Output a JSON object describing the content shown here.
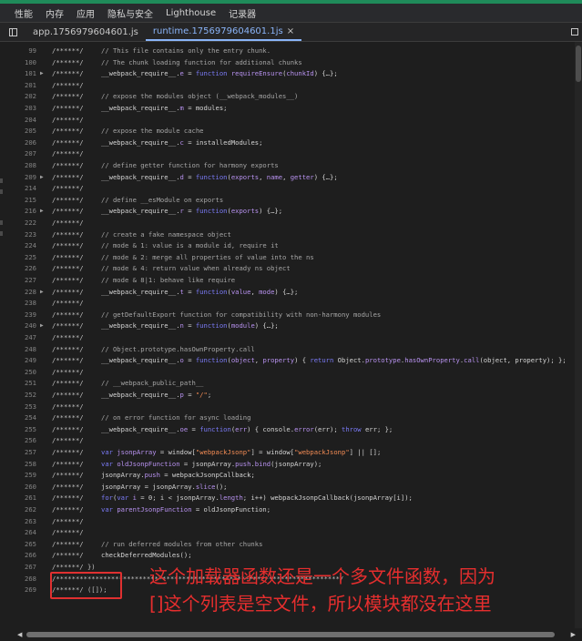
{
  "panel_tabs": [
    "性能",
    "内存",
    "应用",
    "隐私与安全",
    "Lighthouse",
    "记录器"
  ],
  "file_tabs": {
    "app": "app.1756979604601.js",
    "runtime": "runtime.1756979604601.1js",
    "close_glyph": "×"
  },
  "code_lines": [
    {
      "n": "99",
      "f": "",
      "wp": "/******/",
      "t": [
        [
          "// This file contains only the entry chunk.",
          "c"
        ]
      ]
    },
    {
      "n": "100",
      "f": "",
      "wp": "/******/",
      "t": [
        [
          "// The chunk loading function for additional chunks",
          "c"
        ]
      ]
    },
    {
      "n": "101",
      "f": "▶",
      "wp": "/******/",
      "t": [
        [
          "__webpack_require__.",
          ""
        ],
        [
          "e",
          "p"
        ],
        [
          " = ",
          ""
        ],
        [
          "function",
          "k"
        ],
        [
          " ",
          ""
        ],
        [
          "requireEnsure",
          "p"
        ],
        [
          "(",
          ""
        ],
        [
          "chunkId",
          "p"
        ],
        [
          ") {…};",
          ""
        ]
      ]
    },
    {
      "n": "201",
      "f": "",
      "wp": "/******/",
      "t": []
    },
    {
      "n": "202",
      "f": "",
      "wp": "/******/",
      "t": [
        [
          "// expose the modules object (__webpack_modules__)",
          "c"
        ]
      ]
    },
    {
      "n": "203",
      "f": "",
      "wp": "/******/",
      "t": [
        [
          "__webpack_require__.",
          ""
        ],
        [
          "m",
          "p"
        ],
        [
          " = modules;",
          ""
        ]
      ]
    },
    {
      "n": "204",
      "f": "",
      "wp": "/******/",
      "t": []
    },
    {
      "n": "205",
      "f": "",
      "wp": "/******/",
      "t": [
        [
          "// expose the module cache",
          "c"
        ]
      ]
    },
    {
      "n": "206",
      "f": "",
      "wp": "/******/",
      "t": [
        [
          "__webpack_require__.",
          ""
        ],
        [
          "c",
          "p"
        ],
        [
          " = installedModules;",
          ""
        ]
      ]
    },
    {
      "n": "207",
      "f": "",
      "wp": "/******/",
      "t": []
    },
    {
      "n": "208",
      "f": "",
      "wp": "/******/",
      "t": [
        [
          "// define getter function for harmony exports",
          "c"
        ]
      ]
    },
    {
      "n": "209",
      "f": "▶",
      "wp": "/******/",
      "t": [
        [
          "__webpack_require__.",
          ""
        ],
        [
          "d",
          "p"
        ],
        [
          " = ",
          ""
        ],
        [
          "function",
          "k"
        ],
        [
          "(",
          ""
        ],
        [
          "exports",
          "p"
        ],
        [
          ", ",
          ""
        ],
        [
          "name",
          "p"
        ],
        [
          ", ",
          ""
        ],
        [
          "getter",
          "p"
        ],
        [
          ") {…};",
          ""
        ]
      ]
    },
    {
      "n": "214",
      "f": "",
      "wp": "/******/",
      "t": []
    },
    {
      "n": "215",
      "f": "",
      "wp": "/******/",
      "t": [
        [
          "// define __esModule on exports",
          "c"
        ]
      ]
    },
    {
      "n": "216",
      "f": "▶",
      "wp": "/******/",
      "t": [
        [
          "__webpack_require__.",
          ""
        ],
        [
          "r",
          "p"
        ],
        [
          " = ",
          ""
        ],
        [
          "function",
          "k"
        ],
        [
          "(",
          ""
        ],
        [
          "exports",
          "p"
        ],
        [
          ") {…};",
          ""
        ]
      ]
    },
    {
      "n": "222",
      "f": "",
      "wp": "/******/",
      "t": []
    },
    {
      "n": "223",
      "f": "",
      "wp": "/******/",
      "t": [
        [
          "// create a fake namespace object",
          "c"
        ]
      ]
    },
    {
      "n": "224",
      "f": "",
      "wp": "/******/",
      "t": [
        [
          "// mode & 1: value is a module id, require it",
          "c"
        ]
      ]
    },
    {
      "n": "225",
      "f": "",
      "wp": "/******/",
      "t": [
        [
          "// mode & 2: merge all properties of value into the ns",
          "c"
        ]
      ]
    },
    {
      "n": "226",
      "f": "",
      "wp": "/******/",
      "t": [
        [
          "// mode & 4: return value when already ns object",
          "c"
        ]
      ]
    },
    {
      "n": "227",
      "f": "",
      "wp": "/******/",
      "t": [
        [
          "// mode & 8|1: behave like require",
          "c"
        ]
      ]
    },
    {
      "n": "228",
      "f": "▶",
      "wp": "/******/",
      "t": [
        [
          "__webpack_require__.",
          ""
        ],
        [
          "t",
          "p"
        ],
        [
          " = ",
          ""
        ],
        [
          "function",
          "k"
        ],
        [
          "(",
          ""
        ],
        [
          "value",
          "p"
        ],
        [
          ", ",
          ""
        ],
        [
          "mode",
          "p"
        ],
        [
          ") {…};",
          ""
        ]
      ]
    },
    {
      "n": "238",
      "f": "",
      "wp": "/******/",
      "t": []
    },
    {
      "n": "239",
      "f": "",
      "wp": "/******/",
      "t": [
        [
          "// getDefaultExport function for compatibility with non-harmony modules",
          "c"
        ]
      ]
    },
    {
      "n": "240",
      "f": "▶",
      "wp": "/******/",
      "t": [
        [
          "__webpack_require__.",
          ""
        ],
        [
          "n",
          "p"
        ],
        [
          " = ",
          ""
        ],
        [
          "function",
          "k"
        ],
        [
          "(",
          ""
        ],
        [
          "module",
          "p"
        ],
        [
          ") {…};",
          ""
        ]
      ]
    },
    {
      "n": "247",
      "f": "",
      "wp": "/******/",
      "t": []
    },
    {
      "n": "248",
      "f": "",
      "wp": "/******/",
      "t": [
        [
          "// Object.prototype.hasOwnProperty.call",
          "c"
        ]
      ]
    },
    {
      "n": "249",
      "f": "",
      "wp": "/******/",
      "t": [
        [
          "__webpack_require__.",
          ""
        ],
        [
          "o",
          "p"
        ],
        [
          " = ",
          ""
        ],
        [
          "function",
          "k"
        ],
        [
          "(",
          ""
        ],
        [
          "object",
          "p"
        ],
        [
          ", ",
          ""
        ],
        [
          "property",
          "p"
        ],
        [
          ") { ",
          ""
        ],
        [
          "return",
          "k"
        ],
        [
          " Object.",
          ""
        ],
        [
          "prototype",
          "p"
        ],
        [
          ".",
          ""
        ],
        [
          "hasOwnProperty",
          "p"
        ],
        [
          ".",
          ""
        ],
        [
          "call",
          "p"
        ],
        [
          "(object, property); };",
          ""
        ]
      ]
    },
    {
      "n": "250",
      "f": "",
      "wp": "/******/",
      "t": []
    },
    {
      "n": "251",
      "f": "",
      "wp": "/******/",
      "t": [
        [
          "// __webpack_public_path__",
          "c"
        ]
      ]
    },
    {
      "n": "252",
      "f": "",
      "wp": "/******/",
      "t": [
        [
          "__webpack_require__.",
          ""
        ],
        [
          "p",
          "p"
        ],
        [
          " = ",
          ""
        ],
        [
          "\"/\"",
          "s"
        ],
        [
          ";",
          ""
        ]
      ]
    },
    {
      "n": "253",
      "f": "",
      "wp": "/******/",
      "t": []
    },
    {
      "n": "254",
      "f": "",
      "wp": "/******/",
      "t": [
        [
          "// on error function for async loading",
          "c"
        ]
      ]
    },
    {
      "n": "255",
      "f": "",
      "wp": "/******/",
      "t": [
        [
          "__webpack_require__.",
          ""
        ],
        [
          "oe",
          "p"
        ],
        [
          " = ",
          ""
        ],
        [
          "function",
          "k"
        ],
        [
          "(",
          ""
        ],
        [
          "err",
          "p"
        ],
        [
          ") { console.",
          ""
        ],
        [
          "error",
          "p"
        ],
        [
          "(err); ",
          ""
        ],
        [
          "throw",
          "k"
        ],
        [
          " err; };",
          ""
        ]
      ]
    },
    {
      "n": "256",
      "f": "",
      "wp": "/******/",
      "t": []
    },
    {
      "n": "257",
      "f": "",
      "wp": "/******/",
      "t": [
        [
          "var",
          "k"
        ],
        [
          " ",
          ""
        ],
        [
          "jsonpArray",
          "p"
        ],
        [
          " = window[",
          ""
        ],
        [
          "\"webpackJsonp\"",
          "s"
        ],
        [
          "] = window[",
          ""
        ],
        [
          "\"webpackJsonp\"",
          "s"
        ],
        [
          "] || [];",
          ""
        ]
      ]
    },
    {
      "n": "258",
      "f": "",
      "wp": "/******/",
      "t": [
        [
          "var",
          "k"
        ],
        [
          " ",
          ""
        ],
        [
          "oldJsonpFunction",
          "p"
        ],
        [
          " = jsonpArray.",
          ""
        ],
        [
          "push",
          "p"
        ],
        [
          ".",
          ""
        ],
        [
          "bind",
          "p"
        ],
        [
          "(jsonpArray);",
          ""
        ]
      ]
    },
    {
      "n": "259",
      "f": "",
      "wp": "/******/",
      "t": [
        [
          "jsonpArray.",
          ""
        ],
        [
          "push",
          "p"
        ],
        [
          " = webpackJsonpCallback;",
          ""
        ]
      ]
    },
    {
      "n": "260",
      "f": "",
      "wp": "/******/",
      "t": [
        [
          "jsonpArray = jsonpArray.",
          ""
        ],
        [
          "slice",
          "p"
        ],
        [
          "();",
          ""
        ]
      ]
    },
    {
      "n": "261",
      "f": "",
      "wp": "/******/",
      "t": [
        [
          "for",
          "k"
        ],
        [
          "(",
          ""
        ],
        [
          "var",
          "k"
        ],
        [
          " ",
          ""
        ],
        [
          "i",
          "p"
        ],
        [
          " = 0; i < jsonpArray.",
          ""
        ],
        [
          "length",
          "p"
        ],
        [
          "; i++) webpackJsonpCallback(jsonpArray[i]);",
          ""
        ]
      ]
    },
    {
      "n": "262",
      "f": "",
      "wp": "/******/",
      "t": [
        [
          "var",
          "k"
        ],
        [
          " ",
          ""
        ],
        [
          "parentJsonpFunction",
          "p"
        ],
        [
          " = oldJsonpFunction;",
          ""
        ]
      ]
    },
    {
      "n": "263",
      "f": "",
      "wp": "/******/",
      "t": []
    },
    {
      "n": "264",
      "f": "",
      "wp": "/******/",
      "t": []
    },
    {
      "n": "265",
      "f": "",
      "wp": "/******/",
      "t": [
        [
          "// run deferred modules from other chunks",
          "c"
        ]
      ]
    },
    {
      "n": "266",
      "f": "",
      "wp": "/******/",
      "t": [
        [
          "checkDeferredModules();",
          ""
        ]
      ]
    },
    {
      "n": "267",
      "f": "",
      "wp": "/******/ })",
      "t": []
    },
    {
      "n": "268",
      "f": "",
      "wp": "/************************************************************************/",
      "t": []
    },
    {
      "n": "269",
      "f": "",
      "wp": "/******/ ([]);",
      "t": []
    }
  ],
  "annotation": {
    "line1": "这个加载器函数还是一个多文件函数，因为",
    "line2": "[]这个列表是空文件，所以模块都没在这里",
    "color": "#e62e2e"
  },
  "colors": {
    "accent_green": "#1f8b5a",
    "active_tab": "#8ab4f8",
    "keyword": "#7b7bf7",
    "property": "#b892f0",
    "string": "#f28b54"
  }
}
